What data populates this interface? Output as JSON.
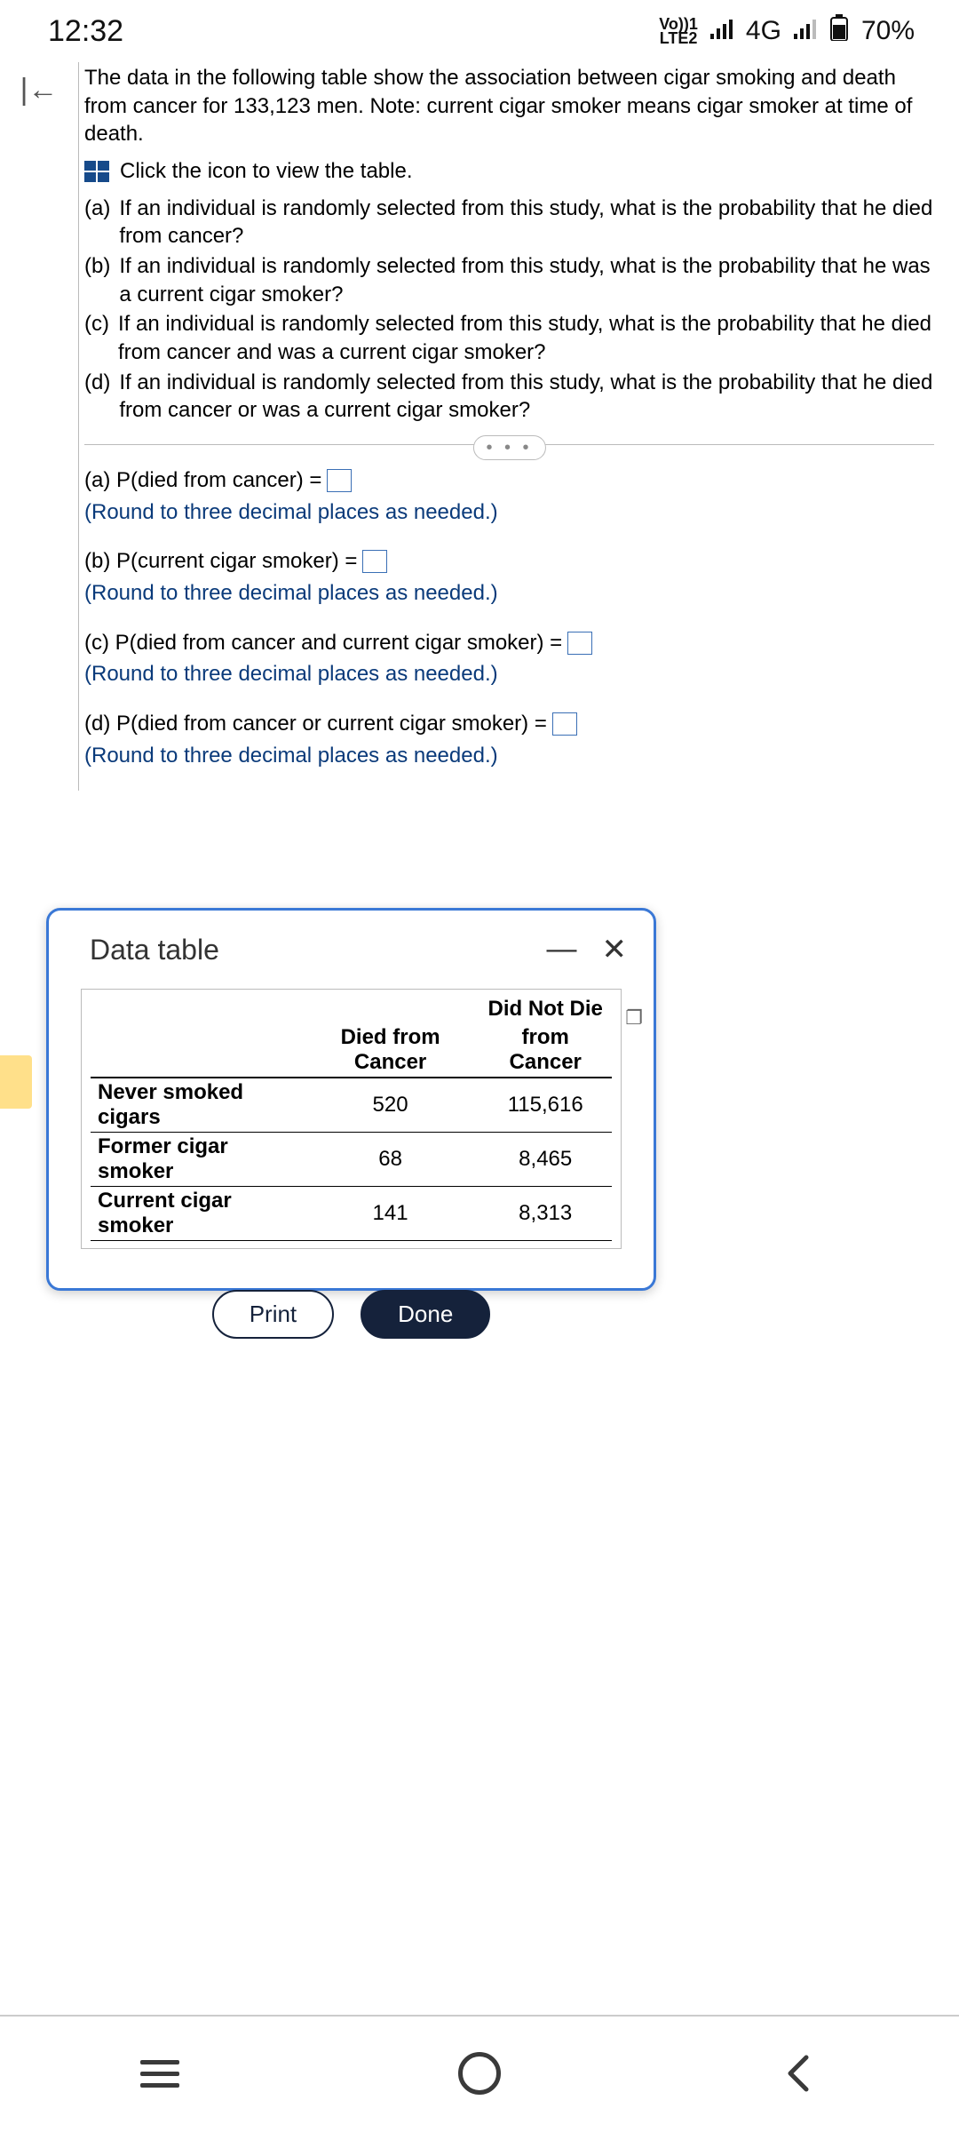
{
  "status": {
    "time": "12:32",
    "vol_top": "Vo))1",
    "vol_bottom": "LTE2",
    "net": "4G",
    "battery": "70%"
  },
  "question": {
    "intro": "The data in the following table show the association between cigar smoking and death from cancer for 133,123 men. Note: current cigar smoker means cigar smoker at time of death.",
    "table_link": "Click the icon to view the table.",
    "items": {
      "a": {
        "label": "(a)",
        "text": "If an individual is randomly selected from this study, what is the probability that he died from cancer?"
      },
      "b": {
        "label": "(b)",
        "text": "If an individual is randomly selected from this study, what is the probability that he was a current cigar smoker?"
      },
      "c": {
        "label": "(c)",
        "text": "If an individual is randomly selected from this study, what is the probability that he died from cancer and was a current cigar smoker?"
      },
      "d": {
        "label": "(d)",
        "text": "If an individual is randomly selected from this study, what is the probability that he died from cancer or was a current cigar smoker?"
      }
    }
  },
  "answers": {
    "a": {
      "text": "(a) P(died from cancer) = ",
      "hint": "(Round to three decimal places as needed.)"
    },
    "b": {
      "text": "(b) P(current cigar smoker) = ",
      "hint": "(Round to three decimal places as needed.)"
    },
    "c": {
      "text": "(c) P(died from cancer and current cigar smoker) = ",
      "hint": "(Round to three decimal places as needed.)"
    },
    "d": {
      "text": "(d) P(died from cancer or current cigar smoker) = ",
      "hint": "(Round to three decimal places as needed.)"
    }
  },
  "ellipsis": "• • •",
  "modal": {
    "title": "Data table",
    "print": "Print",
    "done": "Done",
    "minimize": "—",
    "close": "✕"
  },
  "chart_data": {
    "type": "table",
    "columns": [
      "",
      "Died from Cancer",
      "Did Not Die from Cancer"
    ],
    "rows": [
      {
        "label": "Never smoked cigars",
        "died": "520",
        "not": "115,616"
      },
      {
        "label": "Former cigar smoker",
        "died": "68",
        "not": "8,465"
      },
      {
        "label": "Current cigar smoker",
        "died": "141",
        "not": "8,313"
      }
    ]
  }
}
